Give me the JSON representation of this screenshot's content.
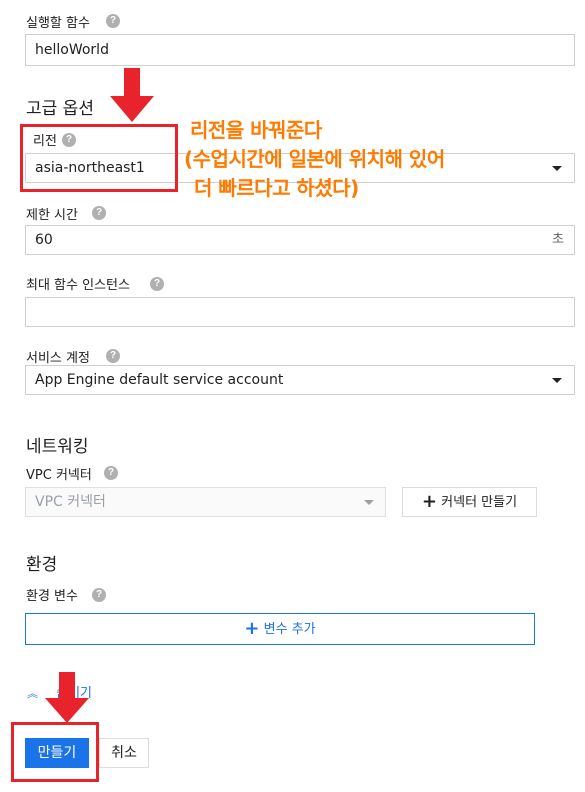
{
  "function_to_run": {
    "label": "실행할 함수",
    "value": "helloWorld"
  },
  "advanced_options": {
    "title": "고급 옵션"
  },
  "region": {
    "label": "리전",
    "value": "asia-northeast1"
  },
  "timeout": {
    "label": "제한 시간",
    "value": "60",
    "unit": "초"
  },
  "max_instances": {
    "label": "최대 함수 인스턴스",
    "value": ""
  },
  "service_account": {
    "label": "서비스 계정",
    "value": "App Engine default service account"
  },
  "networking": {
    "title": "네트워킹",
    "vpc_label": "VPC 커넥터",
    "vpc_placeholder": "VPC 커넥터",
    "create_connector_label": "커넥터 만들기"
  },
  "environment": {
    "title": "환경",
    "env_vars_label": "환경 변수",
    "add_var_label": "변수 추가"
  },
  "collapse": {
    "label": "숨기기"
  },
  "actions": {
    "create_label": "만들기",
    "cancel_label": "취소"
  },
  "annotation": {
    "line1": "리전을 바꿔준다",
    "line2": "(수업시간에 일본에 위치해 있어",
    "line3": "더 빠르다고 하셨다)"
  },
  "colors": {
    "accent": "#1a73e8",
    "primary_button": "#1a73e8",
    "annotation": "#ff7a00",
    "highlight": "#e8232b"
  }
}
